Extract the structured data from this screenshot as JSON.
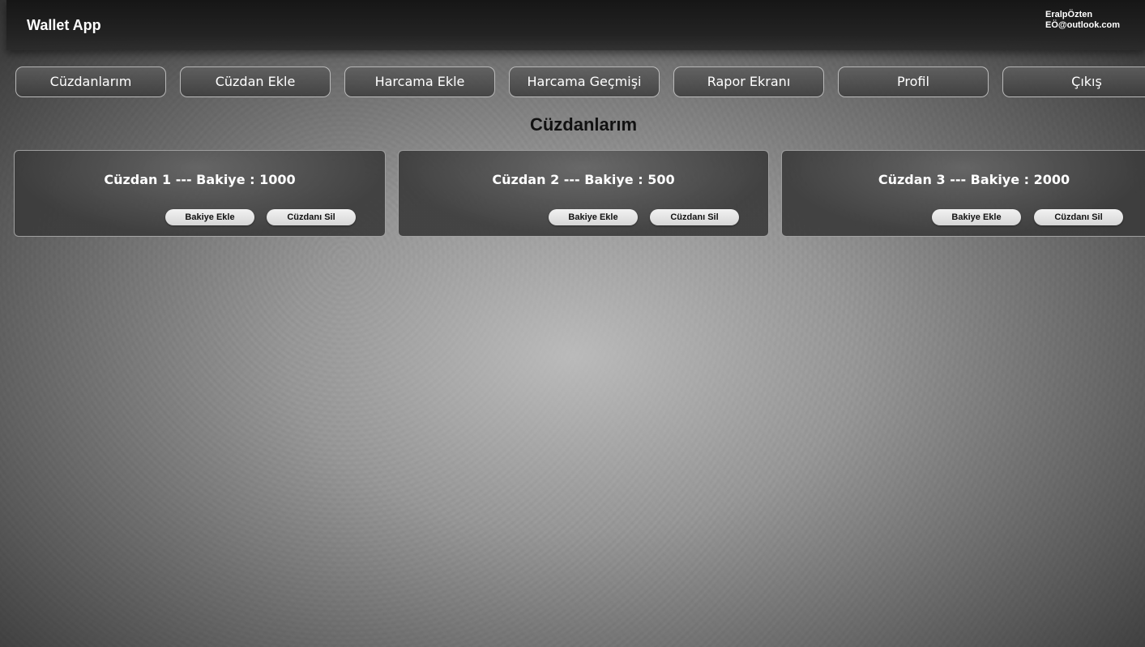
{
  "header": {
    "app_title": "Wallet App",
    "user_name": "EralpÖzten",
    "user_email": "EÖ@outlook.com"
  },
  "nav": {
    "items": [
      {
        "label": "Cüzdanlarım"
      },
      {
        "label": "Cüzdan Ekle"
      },
      {
        "label": "Harcama Ekle"
      },
      {
        "label": "Harcama Geçmişi"
      },
      {
        "label": "Rapor Ekranı"
      },
      {
        "label": "Profil"
      },
      {
        "label": "Çıkış"
      }
    ]
  },
  "main": {
    "title": "Cüzdanlarım",
    "wallets": [
      {
        "title": "Cüzdan 1 --- Bakiye : 1000",
        "add_balance_label": "Bakiye Ekle",
        "delete_label": "Cüzdanı Sil"
      },
      {
        "title": "Cüzdan 2 --- Bakiye : 500",
        "add_balance_label": "Bakiye Ekle",
        "delete_label": "Cüzdanı Sil"
      },
      {
        "title": "Cüzdan 3 --- Bakiye : 2000",
        "add_balance_label": "Bakiye Ekle",
        "delete_label": "Cüzdanı Sil"
      }
    ]
  },
  "colors": {
    "header_bg": "#1c1c1c",
    "nav_button_bg": "#555555",
    "card_bg": "#4a4a4a",
    "card_button_bg": "#e6e6e6",
    "title_text": "#111111"
  }
}
